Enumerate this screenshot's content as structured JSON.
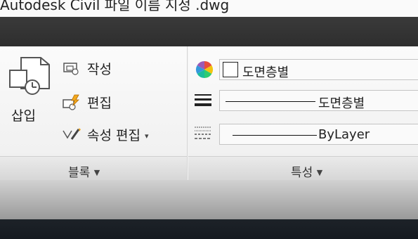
{
  "window": {
    "title": "Autodesk Civil   파일 이름 지정 .dwg"
  },
  "block_panel": {
    "insert_label": "삽입",
    "create_label": "작성",
    "edit_label": "편집",
    "attribute_edit_label": "속성 편집",
    "footer_label": "블록"
  },
  "properties_panel": {
    "color_value": "도면층별",
    "linetype_value": "도면층별",
    "lineweight_value": "ByLayer",
    "footer_label": "특성"
  }
}
